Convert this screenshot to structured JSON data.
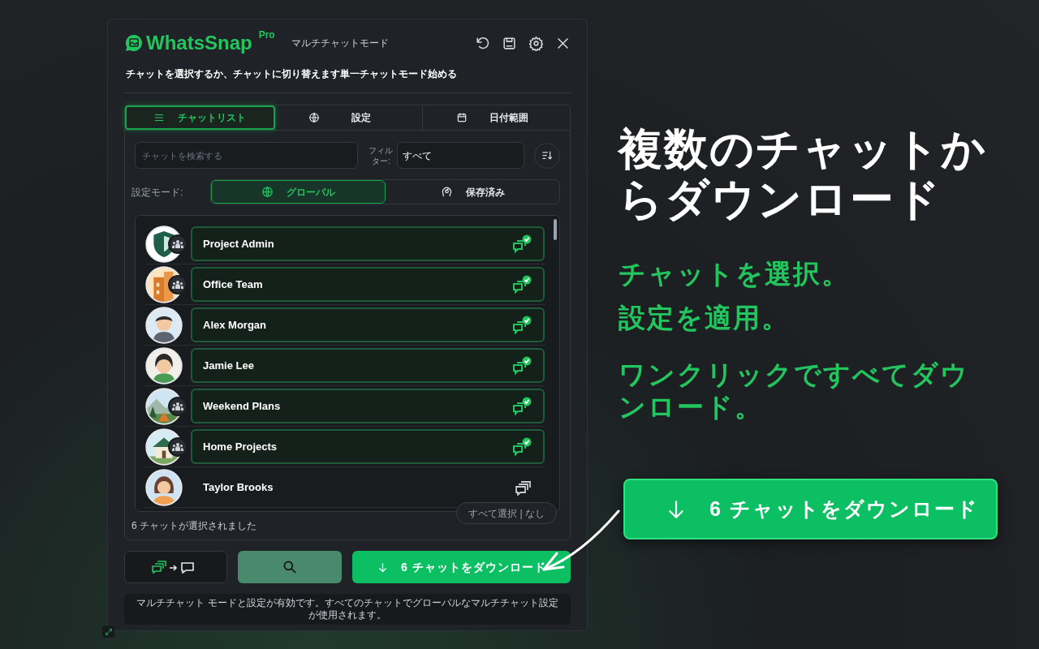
{
  "app": {
    "name": "WhatsSnap",
    "badge": "Pro",
    "mode_label": "マルチチャットモード"
  },
  "instruction": "チャットを選択するか、チャットに切り替えます単一チャットモード始める",
  "tabs": [
    {
      "label": "チャットリスト",
      "selected": true
    },
    {
      "label": "設定",
      "selected": false
    },
    {
      "label": "日付範囲",
      "selected": false
    }
  ],
  "search": {
    "placeholder": "チャットを検索する"
  },
  "filter": {
    "label": "フィルター:",
    "value": "すべて"
  },
  "settings_mode": {
    "label": "設定モード:",
    "options": [
      {
        "label": "グローバル",
        "selected": true
      },
      {
        "label": "保存済み",
        "selected": false
      }
    ]
  },
  "chats": [
    {
      "name": "Project Admin",
      "group": true,
      "selected": true
    },
    {
      "name": "Office Team",
      "group": true,
      "selected": true
    },
    {
      "name": "Alex Morgan",
      "group": false,
      "selected": true
    },
    {
      "name": "Jamie Lee",
      "group": false,
      "selected": true
    },
    {
      "name": "Weekend Plans",
      "group": true,
      "selected": true
    },
    {
      "name": "Home Projects",
      "group": true,
      "selected": true
    },
    {
      "name": "Taylor Brooks",
      "group": false,
      "selected": false
    }
  ],
  "select_all": "すべて選択 | なし",
  "selected_count": "6 チャットが選択されました",
  "download_button": "6 チャットをダウンロード",
  "info": "マルチチャット モードと設定が有効です。すべてのチャットでグローバルなマルチチャット設定が使用されます。",
  "promo": {
    "headline": "複数のチャットからダウンロード",
    "taglines": [
      "チャットを選択。",
      "設定を適用。",
      "ワンクリックですべてダウンロード。"
    ],
    "button": "6 チャットをダウンロード"
  }
}
